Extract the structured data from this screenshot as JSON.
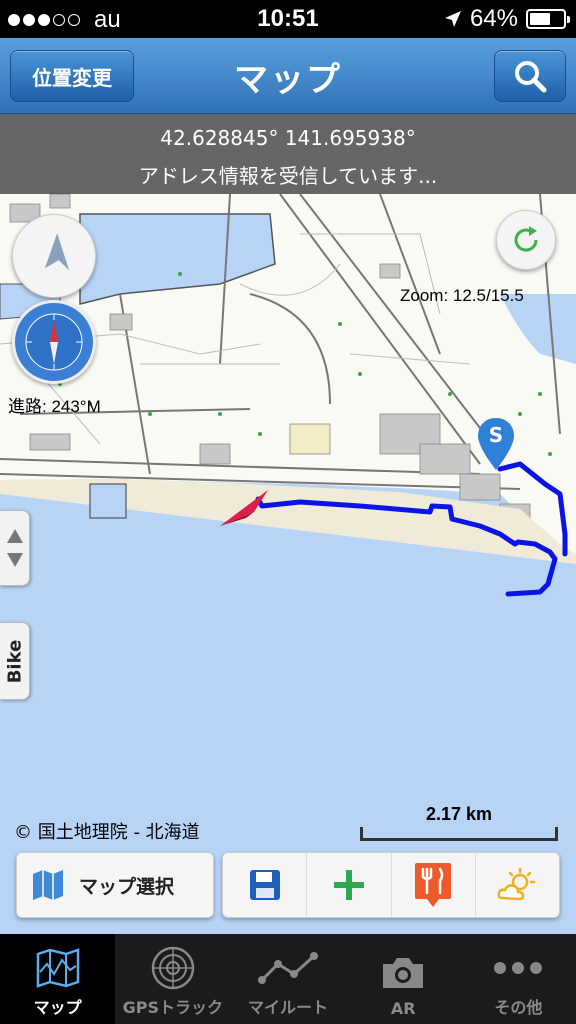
{
  "status_bar": {
    "carrier": "au",
    "time": "10:51",
    "battery": "64%",
    "battery_level": 0.64,
    "signal_bars_filled": 3,
    "signal_bars_total": 5
  },
  "nav": {
    "left_button": "位置変更",
    "title": "マップ",
    "right_icon": "search-icon"
  },
  "map": {
    "coordinates": "42.628845° 141.695938°",
    "address_status": "アドレス情報を受信しています...",
    "zoom": "Zoom: 12.5/15.5",
    "heading": "進路: 243°M",
    "attribution": "© 国土地理院 - 北海道",
    "scale": "2.17 km",
    "bike_tab": "Bike",
    "start_marker": "S",
    "colors": {
      "track": "#0a14e6",
      "marker": "#2f80d6",
      "arrow": "#d81f4d",
      "water": "#b7d3f5"
    }
  },
  "tools": {
    "map_select": "マップ選択",
    "icons": [
      "save-icon",
      "add-icon",
      "restaurant-icon",
      "weather-icon"
    ]
  },
  "tabs": [
    {
      "label": "マップ",
      "icon": "map-icon",
      "active": true
    },
    {
      "label": "GPSトラック",
      "icon": "radar-icon",
      "active": false
    },
    {
      "label": "マイルート",
      "icon": "route-icon",
      "active": false
    },
    {
      "label": "AR",
      "icon": "camera-icon",
      "active": false
    },
    {
      "label": "その他",
      "icon": "more-icon",
      "active": false
    }
  ]
}
